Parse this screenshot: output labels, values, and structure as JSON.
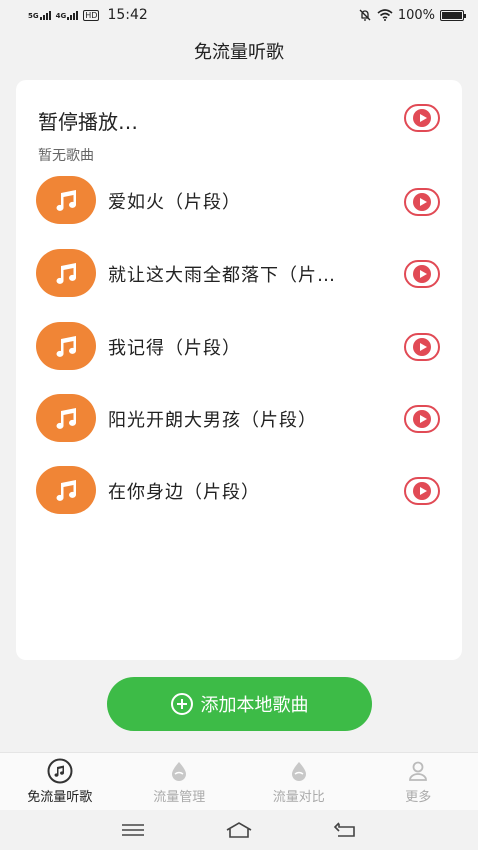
{
  "status": {
    "network_1": "5G",
    "network_2": "4G",
    "hd": "HD",
    "time": "15:42",
    "battery": "100%"
  },
  "header": {
    "title": "免流量听歌"
  },
  "now_playing": {
    "title": "暂停播放…",
    "subtitle": "暂无歌曲"
  },
  "songs": [
    {
      "title": "爱如火（片段）"
    },
    {
      "title": "就让这大雨全都落下（片…"
    },
    {
      "title": "我记得（片段）"
    },
    {
      "title": "阳光开朗大男孩（片段）"
    },
    {
      "title": "在你身边（片段）"
    }
  ],
  "add_button": {
    "label": "添加本地歌曲"
  },
  "tabs": [
    {
      "label": "免流量听歌",
      "icon": "music-disc-icon",
      "active": true
    },
    {
      "label": "流量管理",
      "icon": "drop-icon",
      "active": false
    },
    {
      "label": "流量对比",
      "icon": "drop-icon",
      "active": false
    },
    {
      "label": "更多",
      "icon": "person-icon",
      "active": false
    }
  ],
  "colors": {
    "accent_red": "#e14a55",
    "song_orange": "#f08536",
    "add_green": "#3dbb47"
  }
}
